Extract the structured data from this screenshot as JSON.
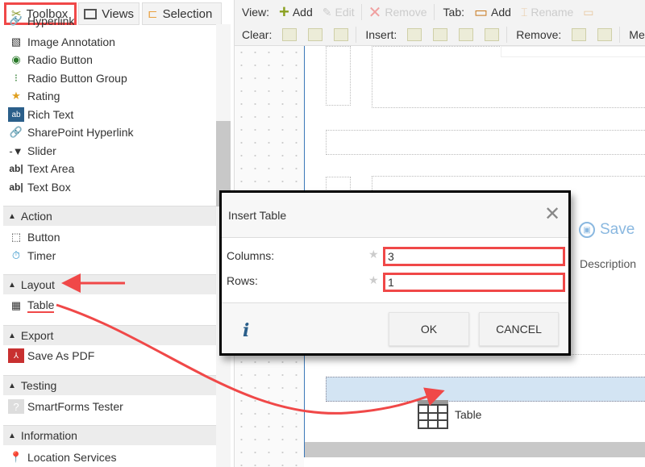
{
  "left_tabs": [
    {
      "label": "Toolbox",
      "icon": "tools-icon"
    },
    {
      "label": "Views",
      "icon": "views-icon"
    },
    {
      "label": "Selection",
      "icon": "tree-icon"
    }
  ],
  "toolbox_items": [
    "Hyperlink",
    "Image Annotation",
    "Radio Button",
    "Radio Button Group",
    "Rating",
    "Rich Text",
    "SharePoint Hyperlink",
    "Slider",
    "Text Area",
    "Text Box"
  ],
  "sections": [
    {
      "title": "Action",
      "items": [
        "Button",
        "Timer"
      ]
    },
    {
      "title": "Layout",
      "items": [
        "Table"
      ]
    },
    {
      "title": "Export",
      "items": [
        "Save As PDF"
      ]
    },
    {
      "title": "Testing",
      "items": [
        "SmartForms Tester"
      ]
    },
    {
      "title": "Information",
      "items": [
        "Location Services"
      ]
    }
  ],
  "toolbar": {
    "view_label": "View:",
    "add": "Add",
    "edit": "Edit",
    "remove": "Remove",
    "tab_label": "Tab:",
    "tab_add": "Add",
    "rename": "Rename",
    "clear_label": "Clear:",
    "insert_label": "Insert:",
    "remove_label": "Remove:",
    "merge_label": "Merg"
  },
  "canvas": {
    "save": "Save",
    "description": "Description",
    "drag_label": "Table"
  },
  "dialog": {
    "title": "Insert Table",
    "columns_label": "Columns:",
    "columns_value": "3",
    "rows_label": "Rows:",
    "rows_value": "1",
    "ok": "OK",
    "cancel": "CANCEL",
    "info": "i"
  },
  "colors": {
    "annotation": "#f04848",
    "accent": "#3b78b8",
    "drop_zone": "#d3e4f3"
  }
}
